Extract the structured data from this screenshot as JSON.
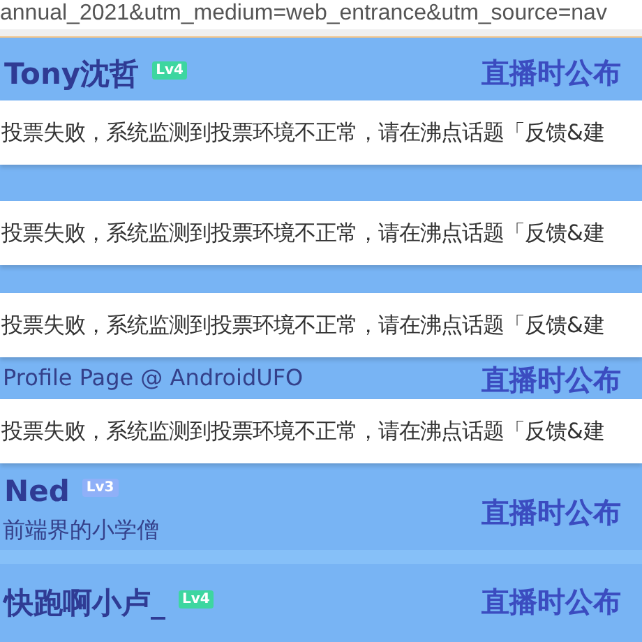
{
  "address_bar": {
    "url": "annual_2021&utm_medium=web_entrance&utm_source=nav"
  },
  "cards": [
    {
      "name": "Tony沈哲",
      "level_badge": {
        "label": "Lv4",
        "color": "#3dd6a0"
      },
      "action": "直播时公布"
    },
    {
      "subtitle": "Profile Page @ AndroidUFO",
      "action": "直播时公布"
    },
    {
      "name": "Ned",
      "level_badge": {
        "label": "Lv3",
        "color": "#8fb0f8"
      },
      "subtitle": "前端界的小学僧",
      "action": "直播时公布"
    },
    {
      "name": "快跑啊小卢_",
      "level_badge": {
        "label": "Lv4",
        "color": "#3dd6a0"
      },
      "action": "直播时公布"
    }
  ],
  "toasts": [
    {
      "message": "投票失败，系统监测到投票环境不正常，请在沸点话题「反馈&建"
    },
    {
      "message": "投票失败，系统监测到投票环境不正常，请在沸点话题「反馈&建"
    },
    {
      "message": "投票失败，系统监测到投票环境不正常，请在沸点话题「反馈&建"
    },
    {
      "message": "投票失败，系统监测到投票环境不正常，请在沸点话题「反馈&建"
    }
  ]
}
